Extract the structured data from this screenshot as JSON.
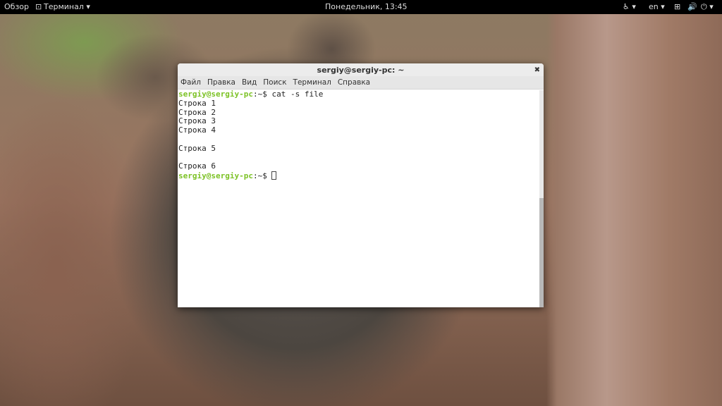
{
  "topbar": {
    "activities": "Обзор",
    "app_menu": "Терминал ▾",
    "clock": "Понедельник, 13:45",
    "lang": "en ▾"
  },
  "window": {
    "title": "sergiy@sergiy-pc: ~",
    "menu": [
      "Файл",
      "Правка",
      "Вид",
      "Поиск",
      "Терминал",
      "Справка"
    ]
  },
  "terminal": {
    "prompt_user": "sergiy@sergiy-pc",
    "prompt_path": ":~$ ",
    "command": "cat -s file",
    "lines": [
      "Строка 1",
      "Строка 2",
      "Строка 3",
      "Строка 4",
      "",
      "Строка 5",
      "",
      "Строка 6"
    ]
  }
}
